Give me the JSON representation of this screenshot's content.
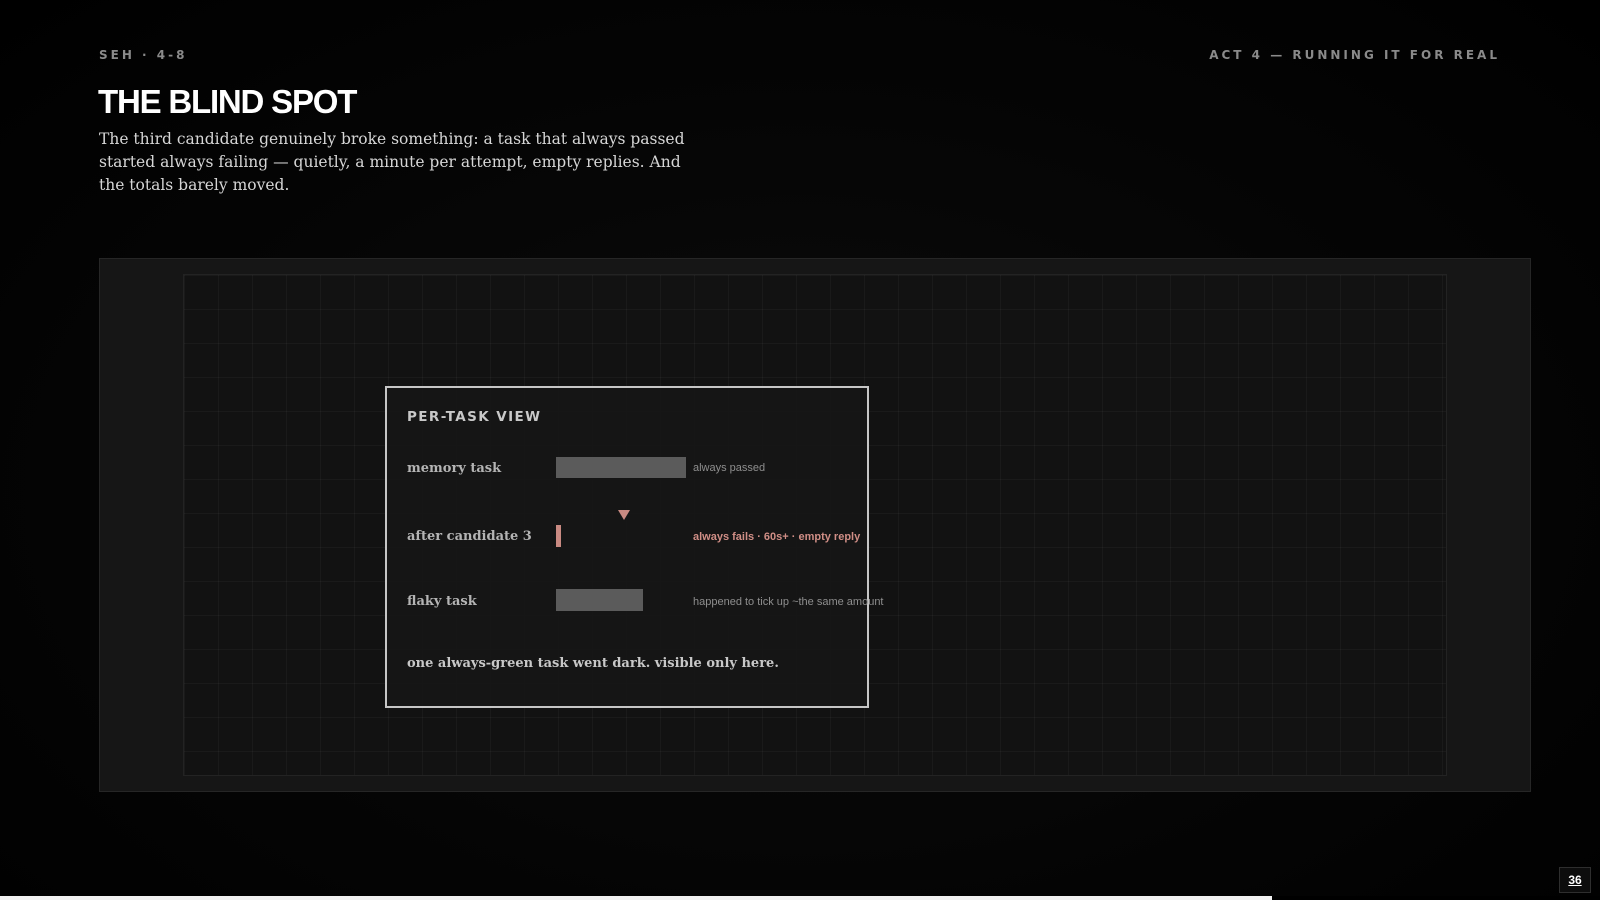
{
  "header": {
    "section_code": "SEH · 4-8",
    "act_label": "ACT 4 — RUNNING IT FOR REAL"
  },
  "slide": {
    "title": "THE BLIND SPOT",
    "lede": "The third candidate genuinely broke something: a task that always passed started always failing — quietly, a minute per attempt, empty replies. And the totals barely moved."
  },
  "card": {
    "title": "PER-TASK VIEW",
    "rows": [
      {
        "label": "memory task",
        "note": "always passed",
        "status": "pass"
      },
      {
        "label": "after candidate 3",
        "note": "always fails · 60s+ · empty reply",
        "status": "fail"
      },
      {
        "label": "flaky task",
        "note": "happened to tick up ~the same amount",
        "status": "flaky"
      }
    ],
    "footer": "one always-green task went dark. visible only here."
  },
  "colors": {
    "accent_fail": "#c98a82",
    "bar_neutral": "#5b5b5b",
    "card_border": "#c6c6c6"
  },
  "footer": {
    "page_number": "36",
    "deck_progress": 0.795
  }
}
